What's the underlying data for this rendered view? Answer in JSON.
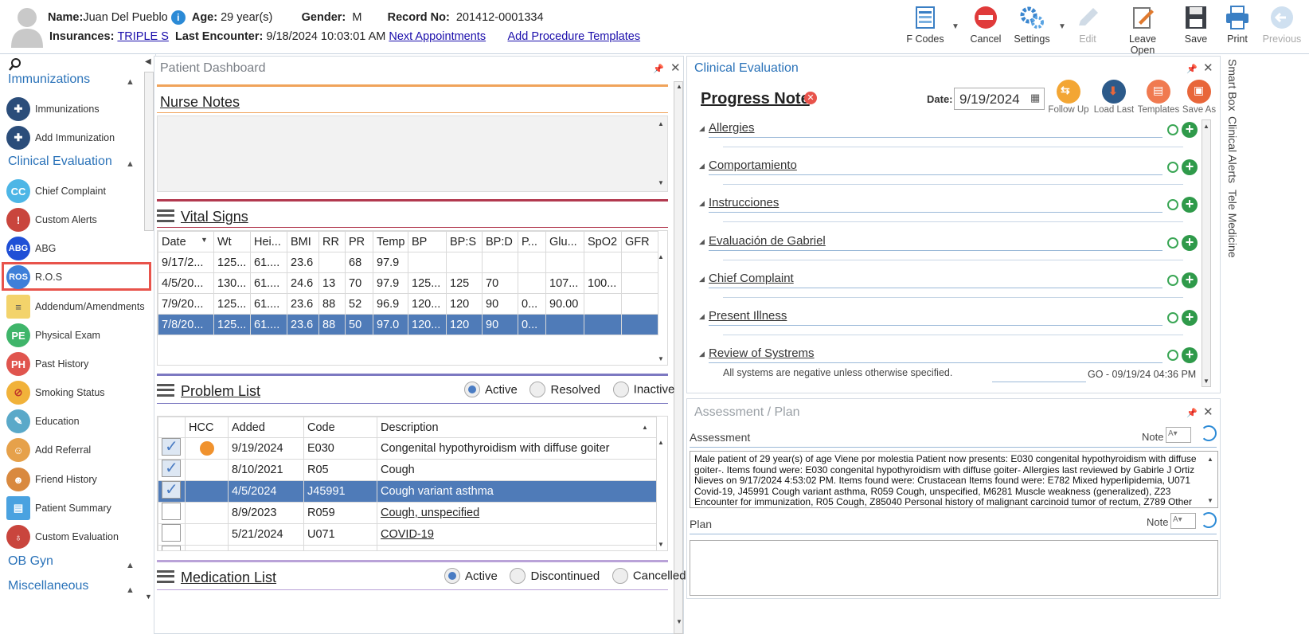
{
  "patient": {
    "name_label": "Name:",
    "name": "Juan Del Pueblo",
    "age_label": "Age:",
    "age": "29 year(s)",
    "gender_label": "Gender:",
    "gender": "M",
    "record_label": "Record No:",
    "record": "201412-0001334",
    "ins_label": "Insurances:",
    "insurance": "TRIPLE S",
    "last_label": "Last Encounter:",
    "last_encounter": "9/18/2024 10:03:01 AM",
    "next_appts": "Next Appointments",
    "add_templates": "Add Procedure Templates"
  },
  "toolbar": {
    "fcodes": "F Codes",
    "cancel": "Cancel",
    "settings": "Settings",
    "edit": "Edit",
    "leave_open": "Leave Open",
    "save": "Save",
    "print": "Print",
    "previous": "Previous"
  },
  "sidebar": {
    "sections": {
      "immunizations": "Immunizations",
      "clinical": "Clinical Evaluation",
      "obgyn": "OB Gyn",
      "misc": "Miscellaneous"
    },
    "items": [
      {
        "label": "Immunizations",
        "abbr": ""
      },
      {
        "label": "Add Immunization",
        "abbr": ""
      },
      {
        "label": "Chief Complaint",
        "abbr": "CC"
      },
      {
        "label": "Custom Alerts",
        "abbr": ""
      },
      {
        "label": "ABG",
        "abbr": "ABG"
      },
      {
        "label": "R.O.S",
        "abbr": "ROS"
      },
      {
        "label": "Addendum/Amendments",
        "abbr": ""
      },
      {
        "label": "Physical Exam",
        "abbr": "PE"
      },
      {
        "label": "Past History",
        "abbr": "PH"
      },
      {
        "label": "Smoking Status",
        "abbr": ""
      },
      {
        "label": "Education",
        "abbr": ""
      },
      {
        "label": "Add Referral",
        "abbr": ""
      },
      {
        "label": "Friend History",
        "abbr": ""
      },
      {
        "label": "Patient Summary",
        "abbr": ""
      },
      {
        "label": "Custom Evaluation",
        "abbr": ""
      }
    ],
    "colors": {
      "cc": "#4db6e6",
      "abg": "#1f4fd6",
      "ros": "#3e7fd9",
      "pe": "#3fb56a",
      "ph": "#e0554e",
      "highlight": "#e8534b"
    }
  },
  "dashboard": {
    "title": "Patient Dashboard",
    "nurse_notes": "Nurse Notes",
    "vital_signs": "Vital Signs",
    "vitals_headers": [
      "Date",
      "Wt",
      "Hei...",
      "BMI",
      "RR",
      "PR",
      "Temp",
      "BP",
      "BP:S",
      "BP:D",
      "P...",
      "Glu...",
      "SpO2",
      "GFR"
    ],
    "vitals_rows": [
      [
        "9/17/2...",
        "125...",
        "61....",
        "23.6",
        "",
        "68",
        "97.9",
        "",
        "",
        "",
        "",
        "",
        "",
        ""
      ],
      [
        "4/5/20...",
        "130...",
        "61....",
        "24.6",
        "13",
        "70",
        "97.9",
        "125...",
        "125",
        "70",
        "",
        "107...",
        "100...",
        ""
      ],
      [
        "7/9/20...",
        "125...",
        "61....",
        "23.6",
        "88",
        "52",
        "96.9",
        "120...",
        "120",
        "90",
        "0...",
        "90.00",
        "",
        ""
      ],
      [
        "7/8/20...",
        "125...",
        "61....",
        "23.6",
        "88",
        "50",
        "97.0",
        "120...",
        "120",
        "90",
        "0...",
        "",
        "",
        ""
      ]
    ],
    "problem_list": "Problem List",
    "problem_filters": [
      "Active",
      "Resolved",
      "Inactive"
    ],
    "problem_headers": [
      "",
      "HCC",
      "Added",
      "Code",
      "Description"
    ],
    "problems": [
      {
        "checked": true,
        "hcc": true,
        "added": "9/19/2024",
        "code": "E030",
        "desc": "Congenital hypothyroidism with diffuse goiter",
        "link": false
      },
      {
        "checked": true,
        "hcc": false,
        "added": "8/10/2021",
        "code": "R05",
        "desc": "Cough",
        "link": false
      },
      {
        "checked": true,
        "hcc": false,
        "added": "4/5/2024",
        "code": "J45991",
        "desc": "Cough variant asthma",
        "link": false
      },
      {
        "checked": false,
        "hcc": false,
        "added": "8/9/2023",
        "code": "R059",
        "desc": "Cough, unspecified",
        "link": true
      },
      {
        "checked": false,
        "hcc": false,
        "added": "5/21/2024",
        "code": "U071",
        "desc": "COVID-19",
        "link": true
      }
    ],
    "medication_list": "Medication List",
    "med_filters": [
      "Active",
      "Discontinued",
      "Cancelled"
    ]
  },
  "clinical_eval": {
    "title": "Clinical Evaluation",
    "note_title": "Progress Note",
    "date_label": "Date:",
    "date": "9/19/2024",
    "actions": [
      "Follow Up",
      "Load Last",
      "Templates",
      "Save As"
    ],
    "sections": [
      "Allergies",
      "Comportamiento",
      "Instrucciones",
      "Evaluación de Gabriel",
      "Chief Complaint",
      "Present Illness",
      "Review of Systrems"
    ],
    "ros_text": "All systems are negative unless otherwise specified.",
    "ros_stamp": "GO - 09/19/24 04:36 PM"
  },
  "assessment": {
    "title": "Assessment / Plan",
    "assessment_label": "Assessment",
    "note_label": "Note",
    "assessment_text": "Male patient of 29 year(s) of age Viene por molestia Patient now presents: E030 congenital hypothyroidism with diffuse goiter-. Items found were: E030 congenital hypothyroidism with diffuse goiter-   Allergies last reviewed by Gabirle J Ortiz Nieves on 9/17/2024 4:53:02 PM.    Items found were:  Crustacean  Items found were:  E782 Mixed hyperlipidemia, U071 Covid-19, J45991 Cough variant asthma, R059 Cough, unspecified, M6281 Muscle weakness (generalized), Z23 Encounter for immunization, R05 Cough, Z85040 Personal history of malignant carcinoid tumor of rectum, Z789 Other",
    "plan_label": "Plan"
  },
  "right_tabs": [
    "Smart Box",
    "Clinical Alerts",
    "Tele Medicine"
  ]
}
